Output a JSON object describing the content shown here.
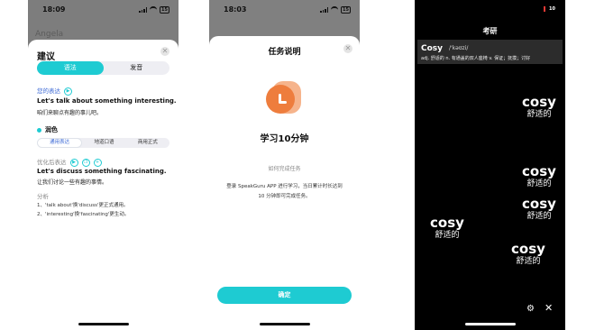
{
  "panel1": {
    "status_time": "18:09",
    "status_battery": "15",
    "bg_title": "Angela",
    "sheet_title": "建议",
    "tabs": [
      "语法",
      "发音"
    ],
    "your_expression_label": "您的表达",
    "original_en": "Let's talk about something interesting.",
    "original_cn": "咱们来聊点有趣的事儿吧。",
    "polish_label": "润色",
    "style_tabs": [
      "通用表达",
      "地道口语",
      "商用正式"
    ],
    "optimized_label": "优化后表达",
    "optimized_en": "Let's discuss something fascinating.",
    "optimized_cn": "让我们讨论一些有趣的事情。",
    "analysis_label": "分析",
    "analysis_1": "1、'talk about'换'discuss'更正式通用。",
    "analysis_2": "2、'interesting'换'fascinating'更生动。"
  },
  "panel2": {
    "status_time": "18:03",
    "status_battery": "15",
    "title": "任务说明",
    "big_text": "学习10分钟",
    "how_label": "如何完成任务",
    "desc_line1": "登录 SpeakGuru APP 进行学习，当日累计时长达到",
    "desc_line2": "10 分钟即可完成任务。",
    "confirm": "确定"
  },
  "panel3": {
    "status_battery": "10",
    "nav_title": "考研",
    "word": "Cosy",
    "phonetic": "/'kəʊzi/",
    "definition": "adj. 舒适的  n. 有通盖的双人座椅  v. 保证；抚摸；讨好",
    "floats": [
      {
        "w": "cosy",
        "m": "舒适的"
      },
      {
        "w": "cosy",
        "m": "舒适的"
      },
      {
        "w": "cosy",
        "m": "舒适的"
      },
      {
        "w": "cosy",
        "m": "舒适的"
      },
      {
        "w": "cosy",
        "m": "舒适的"
      }
    ]
  },
  "colors": {
    "accent": "#1ecbd2",
    "link_blue": "#3d6ad6",
    "clock_orange": "#ee7d3d"
  }
}
